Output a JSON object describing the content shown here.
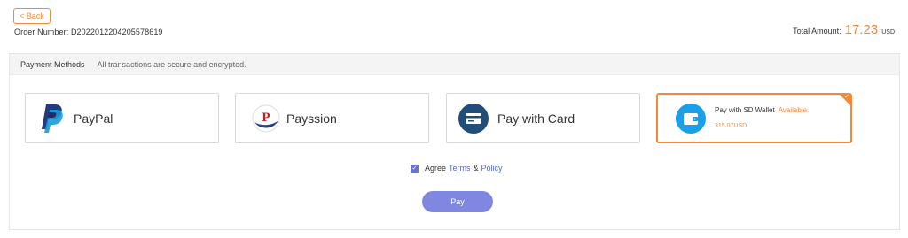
{
  "header": {
    "back_label": "< Back",
    "order_number_label": "Order Number:",
    "order_number": "D2022012204205578619",
    "total_label": "Total Amount:",
    "total_amount": "17.23",
    "currency": "USD"
  },
  "payment": {
    "title": "Payment Methods",
    "subtitle": "All transactions are secure and encrypted.",
    "methods": [
      {
        "label": "PayPal",
        "icon": "paypal-logo-icon"
      },
      {
        "label": "Payssion",
        "icon": "payssion-logo-icon"
      },
      {
        "label": "Pay with Card",
        "icon": "card-icon"
      },
      {
        "label": "Pay with SD Wallet",
        "available_label": "Available:",
        "balance": "315.07USD",
        "icon": "wallet-icon",
        "selected": true
      }
    ]
  },
  "agree": {
    "text": "Agree",
    "terms": "Terms",
    "amp": "&",
    "policy": "Policy"
  },
  "pay_label": "Pay",
  "colors": {
    "accent": "#f5893a",
    "primary": "#7f87e0",
    "card_icon": "#1f4e79",
    "wallet_icon": "#19a0e8"
  }
}
